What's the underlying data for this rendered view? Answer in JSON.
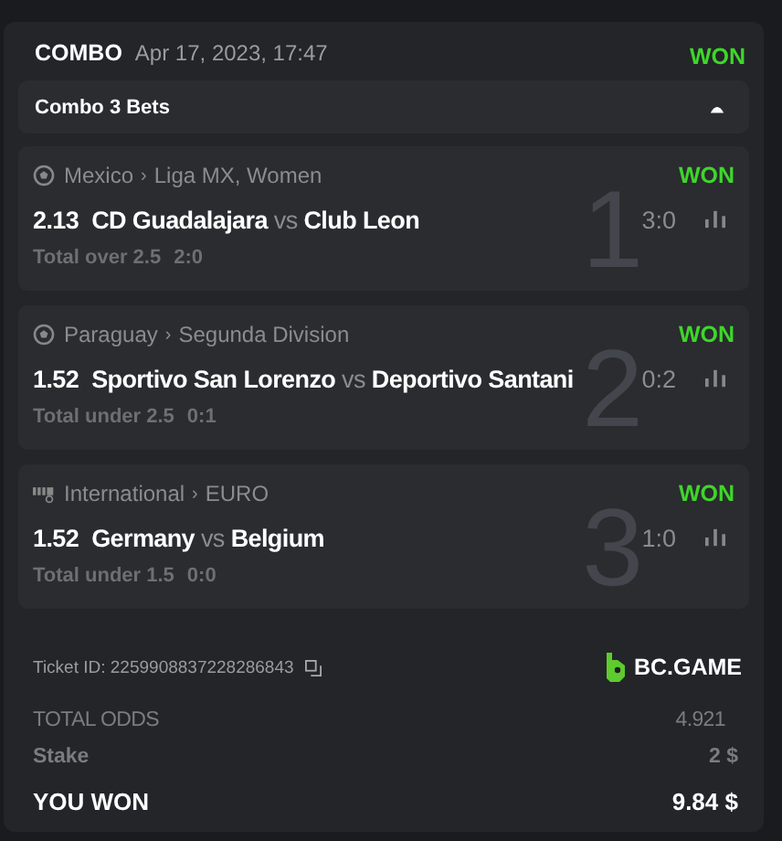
{
  "header": {
    "type": "COMBO",
    "date": "Apr 17, 2023, 17:47",
    "status": "WON"
  },
  "combo_bar": {
    "label": "Combo 3 Bets",
    "expanded": true
  },
  "legs": [
    {
      "kind": "ball",
      "country": "Mexico",
      "separator": "›",
      "league": "Liga MX, Women",
      "status": "WON",
      "odds": "2.13",
      "home": "CD Guadalajara",
      "vs": "vs",
      "away": "Club Leon",
      "score": "3:0",
      "market": "Total over 2.5",
      "pick_score": "2:0",
      "index": "1"
    },
    {
      "kind": "ball",
      "country": "Paraguay",
      "separator": "›",
      "league": "Segunda Division",
      "status": "WON",
      "odds": "1.52",
      "home": "Sportivo San Lorenzo",
      "vs": "vs",
      "away": "Deportivo Santani",
      "score": "0:2",
      "market": "Total under 2.5",
      "pick_score": "0:1",
      "index": "2"
    },
    {
      "kind": "emblem",
      "country": "International",
      "separator": "›",
      "league": "EURO",
      "status": "WON",
      "odds": "1.52",
      "home": "Germany",
      "vs": "vs",
      "away": "Belgium",
      "score": "1:0",
      "market": "Total under 1.5",
      "pick_score": "0:0",
      "index": "3"
    }
  ],
  "ticket": {
    "label": "Ticket ID:",
    "id": "2259908837228286843",
    "brand": "BC.GAME"
  },
  "summary": [
    {
      "label": "TOTAL ODDS",
      "value": "4.921",
      "kind": "odds"
    },
    {
      "label": "Stake",
      "value": "2 $",
      "kind": "stake"
    },
    {
      "label": "YOU WON",
      "value": "9.84 $",
      "kind": "won"
    }
  ]
}
